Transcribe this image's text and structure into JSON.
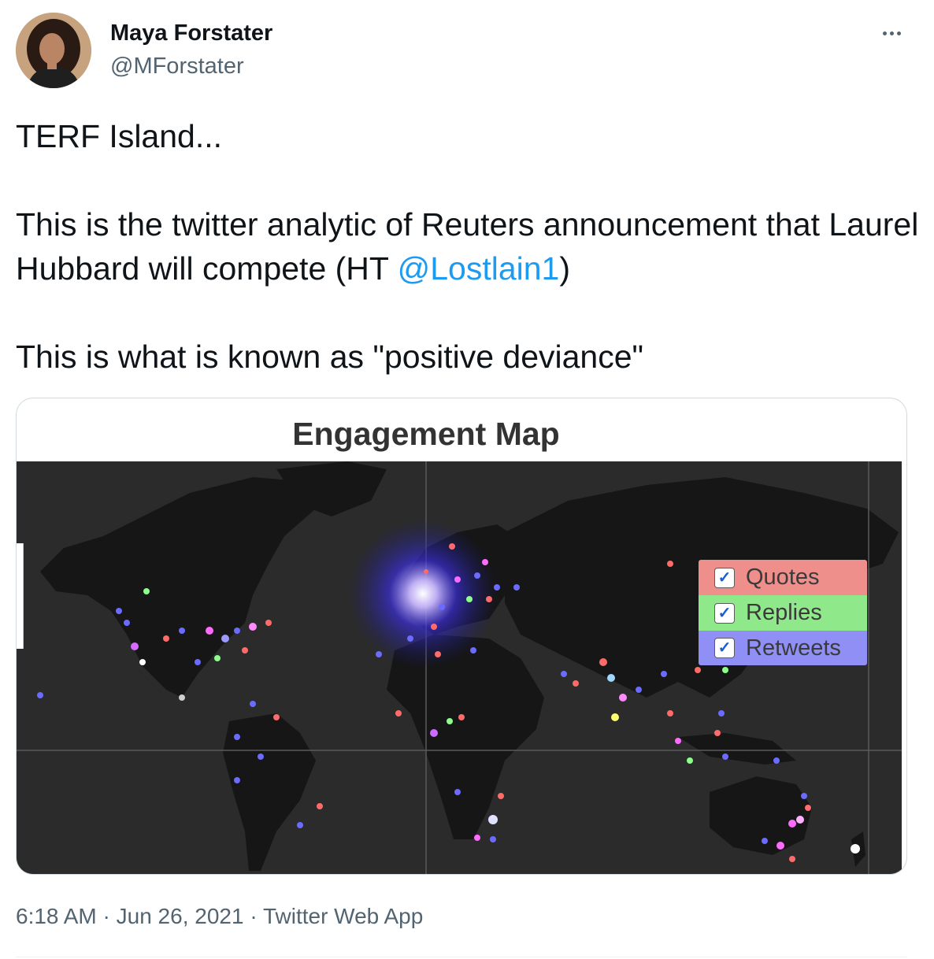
{
  "author": {
    "name": "Maya Forstater",
    "handle": "@MForstater",
    "avatar_icon": "user-avatar-photo"
  },
  "more_icon": "more-options-icon",
  "tweet": {
    "line1": "TERF Island...",
    "line2_pre": "This is the twitter analytic of Reuters announcement that Laurel Hubbard will compete (HT ",
    "mention": "@Lostlain1",
    "line2_post": ")",
    "line3": "This is what is known as \"positive deviance\""
  },
  "media": {
    "title": "Engagement Map",
    "legend": [
      {
        "label": "Quotes",
        "checked": true,
        "color": "#ef8f8c"
      },
      {
        "label": "Replies",
        "checked": true,
        "color": "#8fe98a"
      },
      {
        "label": "Retweets",
        "checked": true,
        "color": "#8f8ff5"
      }
    ]
  },
  "meta": {
    "time": "6:18 AM",
    "sep1": " · ",
    "date": "Jun 26, 2021",
    "sep2": " · ",
    "app": "Twitter Web App"
  }
}
